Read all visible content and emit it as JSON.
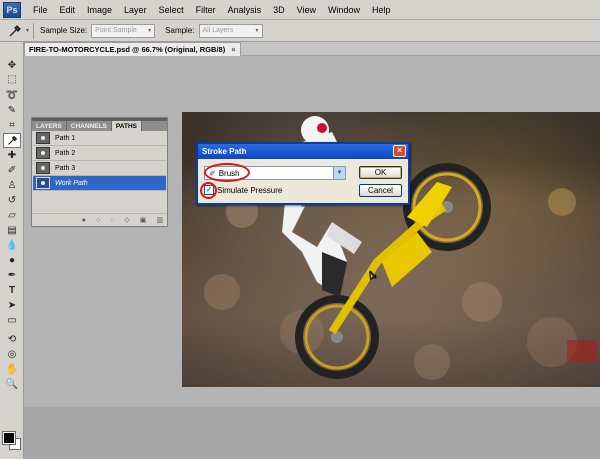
{
  "app": {
    "logo": "Ps"
  },
  "menu": [
    "File",
    "Edit",
    "Image",
    "Layer",
    "Select",
    "Filter",
    "Analysis",
    "3D",
    "View",
    "Window",
    "Help"
  ],
  "options": {
    "tool_icon": "eyedropper-icon",
    "sample_size_label": "Sample Size:",
    "sample_size_value": "Point Sample",
    "sample_label": "Sample:",
    "sample_value": "All Layers"
  },
  "document": {
    "tab_title": "FIRE-TO-MOTORCYCLE.psd @ 66.7% (Original, RGB/8)",
    "close": "×"
  },
  "paths_panel": {
    "tabs": [
      "LAYERS",
      "CHANNELS",
      "PATHS"
    ],
    "active_tab": "PATHS",
    "items": [
      "Path 1",
      "Path 2",
      "Path 3",
      "Work Path"
    ],
    "selected": "Work Path"
  },
  "stroke_dialog": {
    "title": "Stroke Path",
    "tool_value": "Brush",
    "simulate_label": "Simulate Pressure",
    "simulate_checked": true,
    "ok_label": "OK",
    "cancel_label": "Cancel",
    "highlight_color": "#e0141a"
  },
  "colors": {
    "selection": "#3166c4",
    "dialog_title": "#0a46c4"
  }
}
